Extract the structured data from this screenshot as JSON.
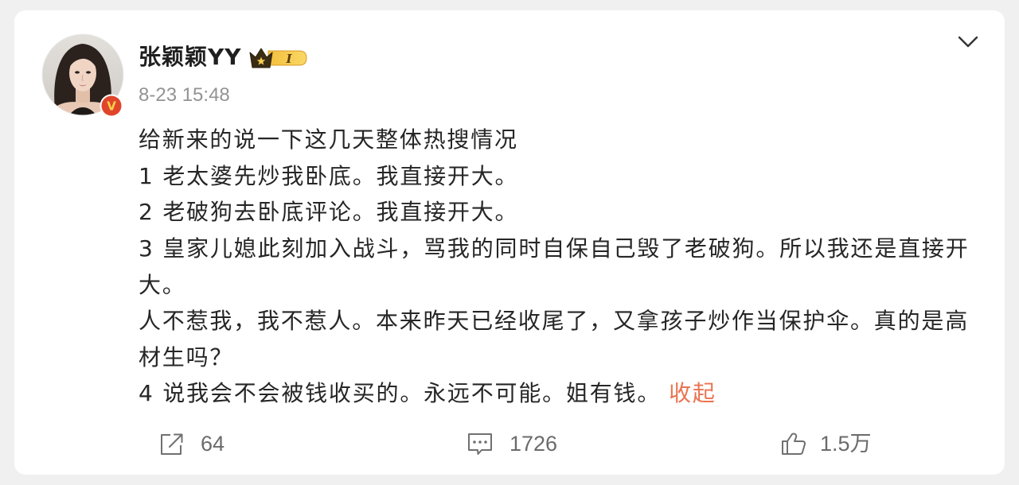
{
  "colors": {
    "background": "#f0f0f0",
    "text": "#262626",
    "muted": "#939393",
    "icon": "#6b6b6b",
    "link": "#eb7350",
    "verified": "#e0452b"
  },
  "post": {
    "author": {
      "name": "张颖颖YY",
      "avatar_icon": "avatar-photo",
      "verified_badge": "V",
      "member_badge_icon": "crown-icon",
      "member_badge_level": "I"
    },
    "timestamp": "8-23 15:48",
    "menu_icon": "chevron-down-icon",
    "paragraphs": [
      "给新来的说一下这几天整体热搜情况",
      "1 老太婆先炒我卧底。我直接开大。",
      "2 老破狗去卧底评论。我直接开大。",
      "3 皇家儿媳此刻加入战斗，骂我的同时自保自己毁了老破狗。所以我还是直接开大。",
      "人不惹我，我不惹人。本来昨天已经收尾了，又拿孩子炒作当保护伞。真的是高材生吗？",
      "4 说我会不会被钱收买的。永远不可能。姐有钱。"
    ],
    "collapse_label": "收起",
    "actions": {
      "share": {
        "icon": "share-icon",
        "count": "64"
      },
      "comment": {
        "icon": "comment-icon",
        "count": "1726"
      },
      "like": {
        "icon": "like-icon",
        "count": "1.5万"
      }
    }
  }
}
